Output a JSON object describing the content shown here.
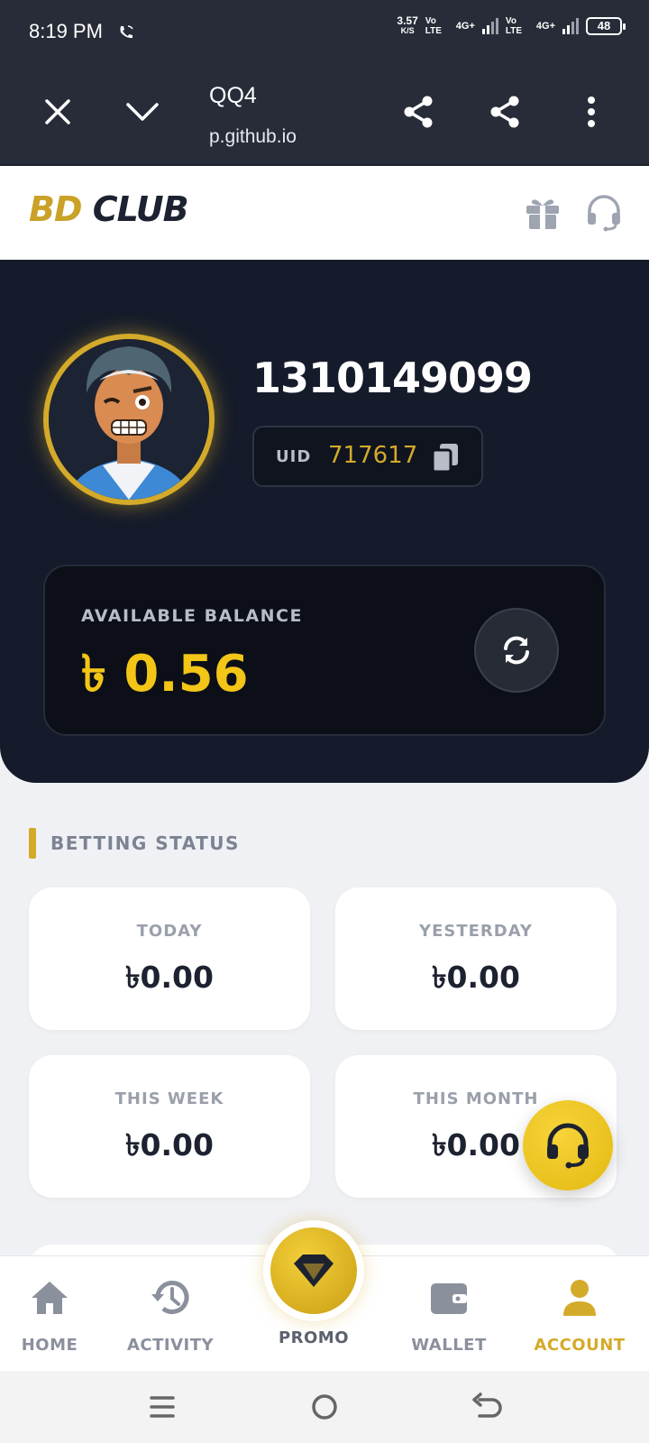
{
  "status_bar": {
    "time": "8:19 PM",
    "net_speed_value": "3.57",
    "net_speed_unit": "K/S",
    "sim1_label": "Vo LTE",
    "sim1_net": "4G+",
    "sim2_label": "Vo LTE",
    "sim2_net": "4G+",
    "battery": "48"
  },
  "browser": {
    "title": "QQ4",
    "url": "p.github.io",
    "icons": [
      "close-icon",
      "chevron-down-icon",
      "share-icon",
      "share-icon",
      "more-vertical-icon"
    ]
  },
  "app": {
    "logo_part1": "BD",
    "logo_part2": "CLUB",
    "header_icons": [
      "gift-icon",
      "headset-icon"
    ]
  },
  "profile": {
    "username": "1310149099",
    "uid_label": "UID",
    "uid_value": "717617"
  },
  "balance": {
    "label": "AVAILABLE BALANCE",
    "value": "৳ 0.56"
  },
  "betting_status": {
    "title": "BETTING STATUS",
    "cards": [
      {
        "label": "TODAY",
        "value": "৳0.00"
      },
      {
        "label": "YESTERDAY",
        "value": "৳0.00"
      },
      {
        "label": "THIS WEEK",
        "value": "৳0.00"
      },
      {
        "label": "THIS MONTH",
        "value": "৳0.00"
      }
    ]
  },
  "nav": {
    "items": [
      {
        "label": "HOME",
        "icon": "home-icon"
      },
      {
        "label": "ACTIVITY",
        "icon": "history-icon"
      },
      {
        "label": "PROMO",
        "icon": "diamond-icon"
      },
      {
        "label": "WALLET",
        "icon": "wallet-icon"
      },
      {
        "label": "ACCOUNT",
        "icon": "user-icon"
      }
    ],
    "active": "ACCOUNT"
  },
  "colors": {
    "gold": "#d4aa2a",
    "balance_yellow": "#f2c517",
    "dark_navy": "#151b2a",
    "browser_bar": "#272c38"
  }
}
